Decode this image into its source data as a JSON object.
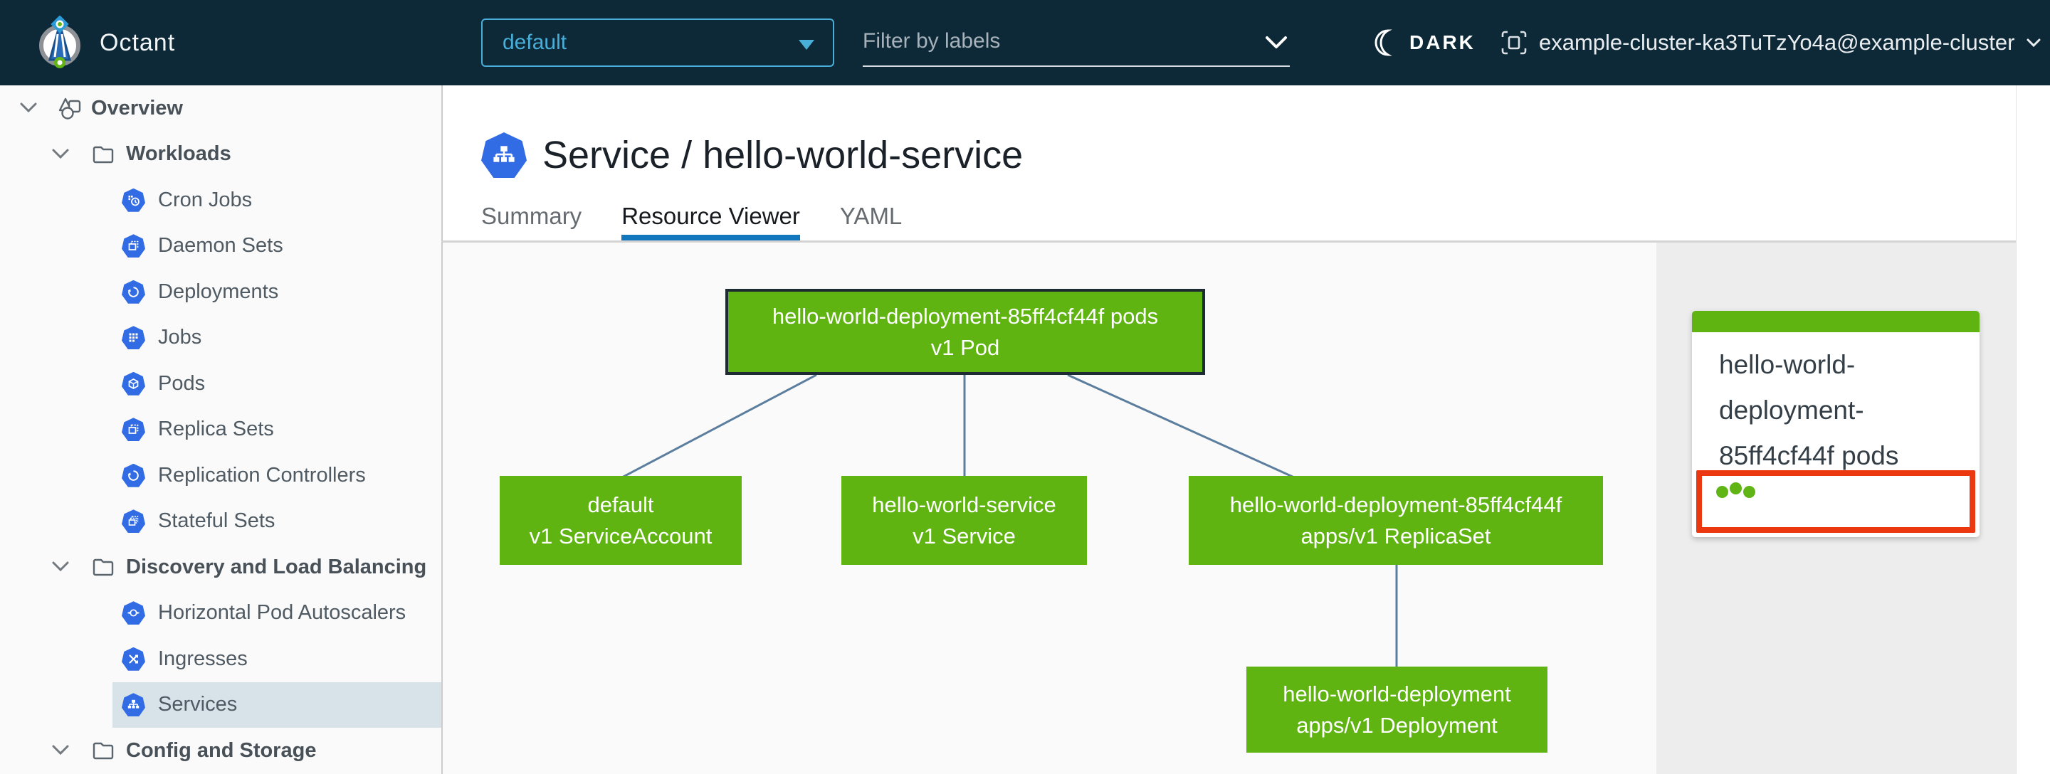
{
  "navbar": {
    "app_title": "Octant",
    "namespace_selector": {
      "value": "default"
    },
    "filter_input": {
      "placeholder": "Filter by labels"
    },
    "theme_toggle": {
      "label": "DARK"
    },
    "context": {
      "label": "example-cluster-ka3TuTzYo4a@example-cluster"
    }
  },
  "sidebar": {
    "items": [
      {
        "label": "Overview"
      },
      {
        "label": "Workloads"
      },
      {
        "label": "Cron Jobs"
      },
      {
        "label": "Daemon Sets"
      },
      {
        "label": "Deployments"
      },
      {
        "label": "Jobs"
      },
      {
        "label": "Pods"
      },
      {
        "label": "Replica Sets"
      },
      {
        "label": "Replication Controllers"
      },
      {
        "label": "Stateful Sets"
      },
      {
        "label": "Discovery and Load Balancing"
      },
      {
        "label": "Horizontal Pod Autoscalers"
      },
      {
        "label": "Ingresses"
      },
      {
        "label": "Services",
        "selected": true
      },
      {
        "label": "Config and Storage"
      }
    ]
  },
  "header": {
    "title": "Service / hello-world-service",
    "tabs": [
      {
        "label": "Summary",
        "active": false
      },
      {
        "label": "Resource Viewer",
        "active": true
      },
      {
        "label": "YAML",
        "active": false
      }
    ]
  },
  "graph": {
    "nodes": [
      {
        "id": "pod",
        "name": "hello-world-deployment-85ff4cf44f pods",
        "kind": "v1 Pod",
        "selected": true
      },
      {
        "id": "serviceaccount",
        "name": "default",
        "kind": "v1 ServiceAccount"
      },
      {
        "id": "service",
        "name": "hello-world-service",
        "kind": "v1 Service"
      },
      {
        "id": "replicaset",
        "name": "hello-world-deployment-85ff4cf44f",
        "kind": "apps/v1 ReplicaSet"
      },
      {
        "id": "deployment",
        "name": "hello-world-deployment",
        "kind": "apps/v1 Deployment"
      }
    ],
    "edges": [
      {
        "from": "pod",
        "to": "serviceaccount"
      },
      {
        "from": "pod",
        "to": "service"
      },
      {
        "from": "pod",
        "to": "replicaset"
      },
      {
        "from": "replicaset",
        "to": "deployment"
      }
    ]
  },
  "panel": {
    "card": {
      "title": "hello-world-deployment-85ff4cf44f pods",
      "status_dots": 3
    }
  },
  "icons": {
    "octant-logo": "compass-circle",
    "dropdown-caret-icon": "triangle-down",
    "chevron-down-icon": "v-shape",
    "moon-icon": "crescent",
    "host-icon": "bracketed-square",
    "overview-icon": "objects-outline",
    "folder-icon": "folder-outline",
    "k8s-resource-icon": "blue-heptagon",
    "pod-status-dot": "green-circle"
  },
  "colors": {
    "navbar_bg": "#0d2937",
    "navbar_accent": "#49afd9",
    "k8s_blue": "#326ce5",
    "node_green": "#5fb411",
    "status_green": "#60b515",
    "alert_red": "#ec3810",
    "tab_indicator_blue": "#1277bd",
    "selected_row_bg": "#d8e3e9",
    "panel_bg": "#ededed"
  }
}
